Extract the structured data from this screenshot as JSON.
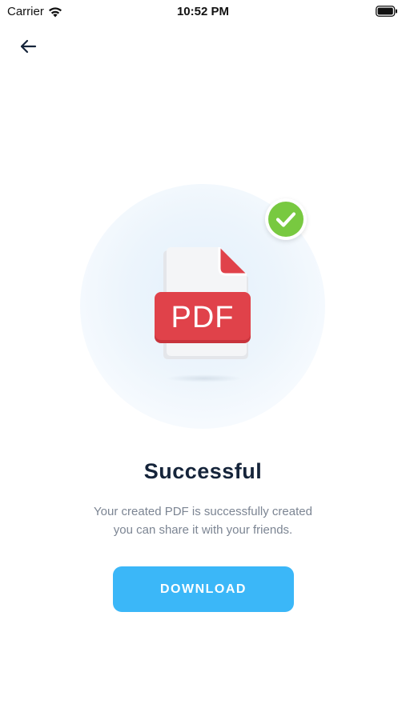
{
  "status_bar": {
    "carrier": "Carrier",
    "time": "10:52 PM",
    "wifi_icon": "wifi-icon",
    "battery_icon": "battery-icon"
  },
  "navigation": {
    "back_icon": "arrow-left-icon"
  },
  "illustration": {
    "file_label": "PDF",
    "file_icon": "pdf-file-icon",
    "badge_icon": "check-circle-icon",
    "colors": {
      "pdf_red": "#e0424a",
      "check_green": "#78c940",
      "halo": "#e8f3fc"
    }
  },
  "content": {
    "title": "Successful",
    "message_line1": "Your created PDF is successfully created",
    "message_line2": "you can share it with your friends."
  },
  "actions": {
    "download_label": "DOWNLOAD",
    "accent_color": "#3bb7f8"
  }
}
